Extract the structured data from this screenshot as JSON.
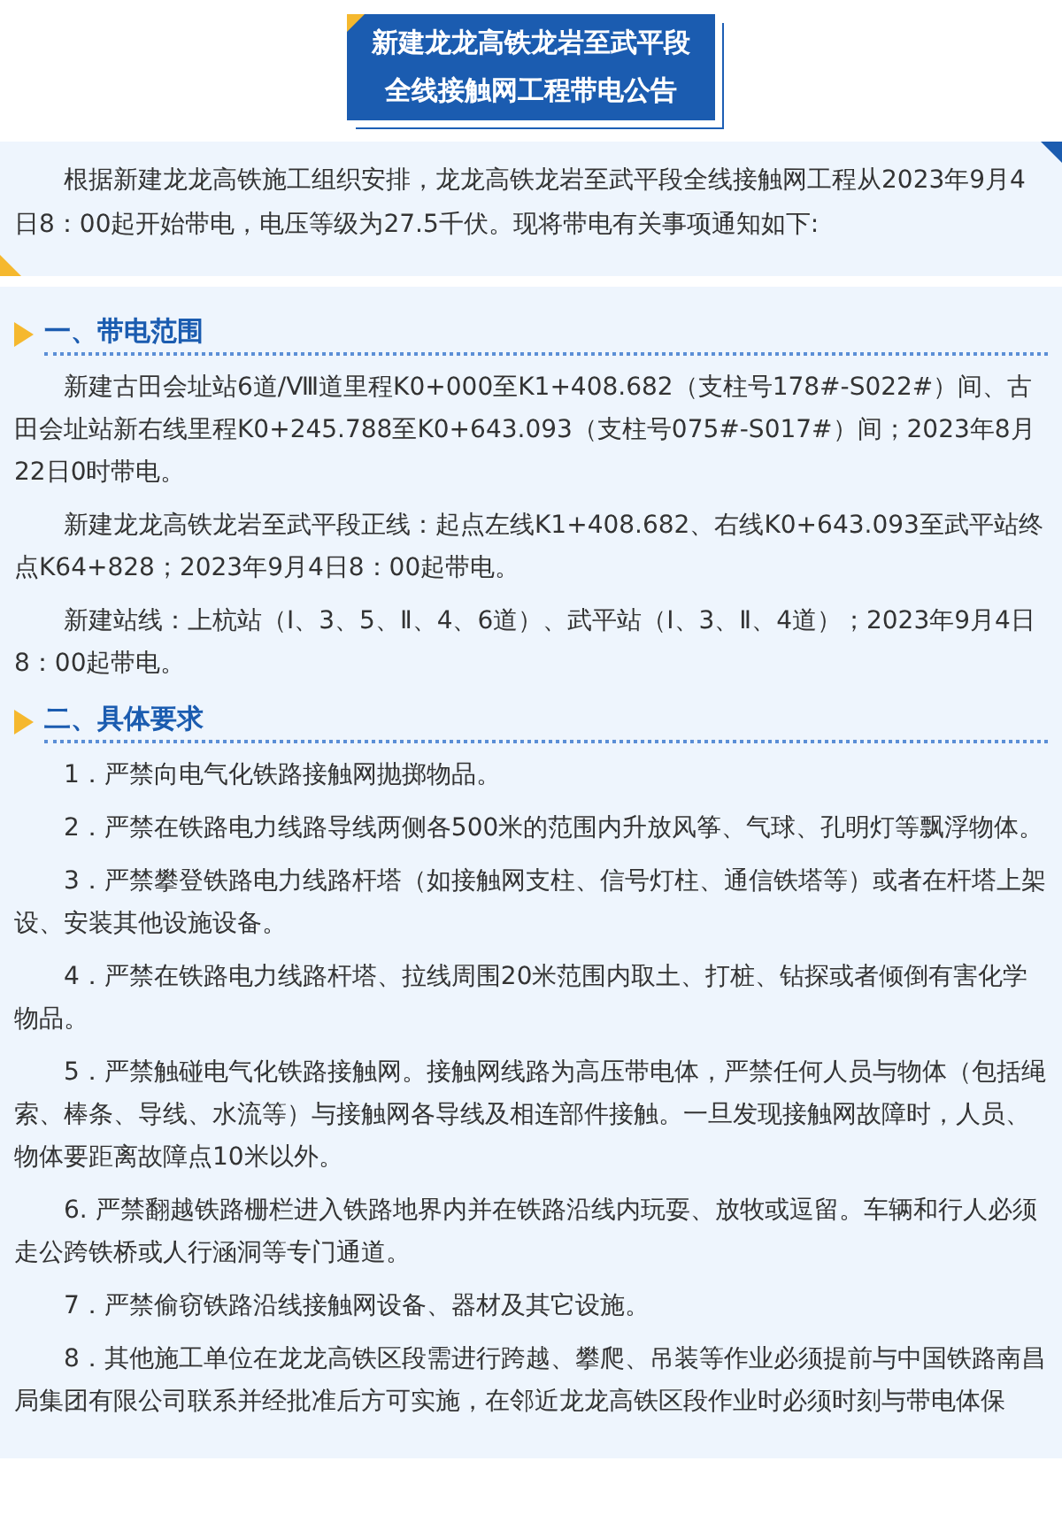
{
  "title": {
    "lines": [
      "新建龙龙高铁龙岩至武平段",
      "全线接触网工程带电公告"
    ]
  },
  "intro": "根据新建龙龙高铁施工组织安排，龙龙高铁龙岩至武平段全线接触网工程从2023年9月4日8：00起开始带电，电压等级为27.5千伏。现将带电有关事项通知如下:",
  "sections": [
    {
      "heading": "一、带电范围",
      "paragraphs": [
        "新建古田会址站6道/Ⅷ道里程K0+000至K1+408.682（支柱号178#-S022#）间、古田会址站新右线里程K0+245.788至K0+643.093（支柱号075#-S017#）间；2023年8月22日0时带电。",
        "新建龙龙高铁龙岩至武平段正线：起点左线K1+408.682、右线K0+643.093至武平站终点K64+828；2023年9月4日8：00起带电。",
        "新建站线：上杭站（Ⅰ、3、5、Ⅱ、4、6道）、武平站（Ⅰ、3、Ⅱ、4道）；2023年9月4日8：00起带电。"
      ]
    },
    {
      "heading": "二、具体要求",
      "paragraphs": [
        "1．严禁向电气化铁路接触网抛掷物品。",
        "2．严禁在铁路电力线路导线两侧各500米的范围内升放风筝、气球、孔明灯等飘浮物体。",
        "3．严禁攀登铁路电力线路杆塔（如接触网支柱、信号灯柱、通信铁塔等）或者在杆塔上架设、安装其他设施设备。",
        "4．严禁在铁路电力线路杆塔、拉线周围20米范围内取土、打桩、钻探或者倾倒有害化学物品。",
        "5．严禁触碰电气化铁路接触网。接触网线路为高压带电体，严禁任何人员与物体（包括绳索、棒条、导线、水流等）与接触网各导线及相连部件接触。一旦发现接触网故障时，人员、物体要距离故障点10米以外。",
        "6. 严禁翻越铁路栅栏进入铁路地界内并在铁路沿线内玩耍、放牧或逗留。车辆和行人必须走公跨铁桥或人行涵洞等专门通道。",
        "7．严禁偷窃铁路沿线接触网设备、器材及其它设施。",
        "8．其他施工单位在龙龙高铁区段需进行跨越、攀爬、吊装等作业必须提前与中国铁路南昌局集团有限公司联系并经批准后方可实施，在邻近龙龙高铁区段作业时必须时刻与带电体保"
      ]
    }
  ]
}
